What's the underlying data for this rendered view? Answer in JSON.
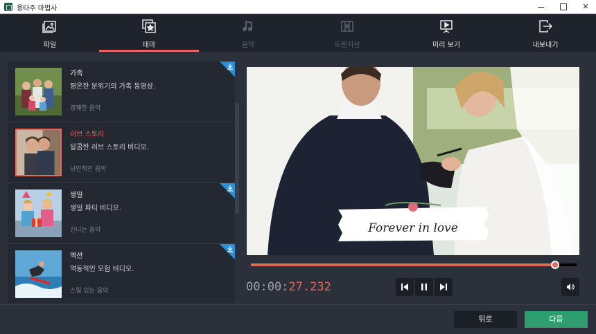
{
  "window": {
    "title": "용타주 마법사"
  },
  "tabs": [
    {
      "label": "파일",
      "icon": "image-file-icon",
      "state": "normal"
    },
    {
      "label": "테마",
      "icon": "theme-star-icon",
      "state": "active"
    },
    {
      "label": "음악",
      "icon": "music-note-icon",
      "state": "disabled"
    },
    {
      "label": "트랜지션",
      "icon": "transition-icon",
      "state": "disabled"
    },
    {
      "label": "미리 보기",
      "icon": "preview-play-icon",
      "state": "normal"
    },
    {
      "label": "내보내기",
      "icon": "export-icon",
      "state": "normal"
    }
  ],
  "themes": [
    {
      "title": "가족",
      "description": "평온한 분위기의 가족 동영상.",
      "music": "경쾌한 음악",
      "downloadable": true,
      "selected": false
    },
    {
      "title": "러브 스토리",
      "description": "달콤한 러브 스토리 비디오.",
      "music": "낭만적인 음악",
      "downloadable": false,
      "selected": true
    },
    {
      "title": "생일",
      "description": "생일 파티 비디오.",
      "music": "신나는 음악",
      "downloadable": true,
      "selected": false
    },
    {
      "title": "액션",
      "description": "역동적인 모험 비디오.",
      "music": "스릴 있는 음악",
      "downloadable": true,
      "selected": false
    }
  ],
  "preview": {
    "caption": "Forever in love"
  },
  "player": {
    "timecode_prefix": "00:00:",
    "timecode_value": "27.232",
    "progress": 0.935
  },
  "footer": {
    "back_label": "뒤로",
    "next_label": "다음"
  },
  "colors": {
    "accent": "#e8675a",
    "next_button": "#2e9e6e",
    "download_badge": "#2f8fd6"
  }
}
